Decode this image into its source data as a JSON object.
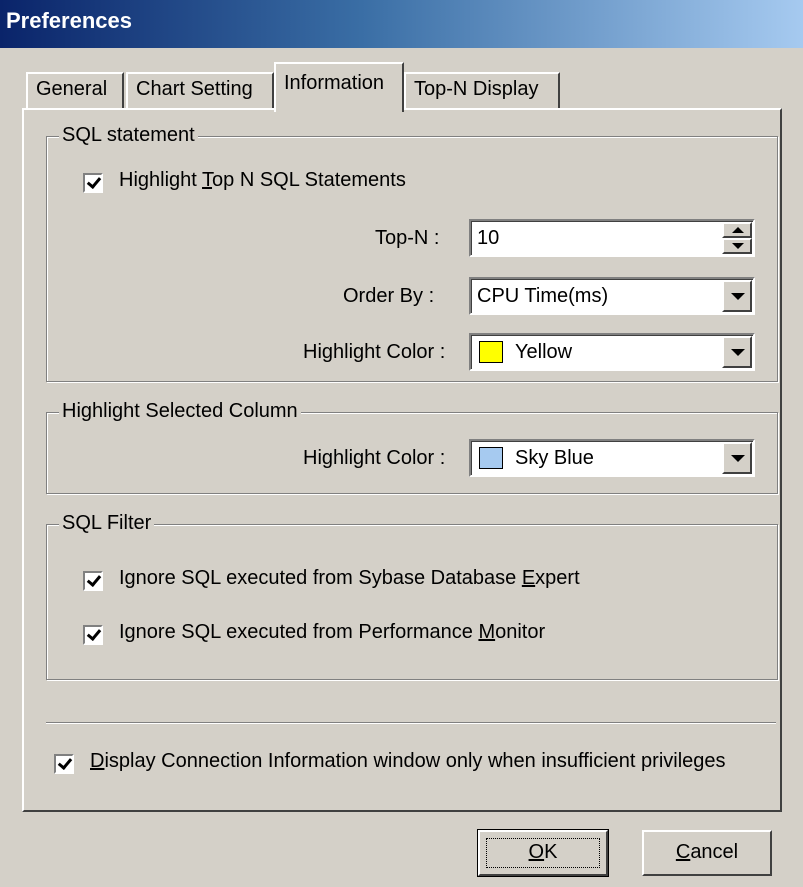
{
  "window": {
    "title": "Preferences"
  },
  "tabs": [
    {
      "label": "General",
      "active": false
    },
    {
      "label": "Chart Setting",
      "active": false
    },
    {
      "label": "Information",
      "active": true
    },
    {
      "label": "Top-N Display",
      "active": false
    }
  ],
  "sql_statement": {
    "legend": "SQL statement",
    "highlight_top_n": {
      "pre": "Highlight ",
      "key": "T",
      "post": "op N SQL Statements",
      "checked": true
    },
    "top_n": {
      "label": "Top-N :",
      "value": "10"
    },
    "order_by": {
      "label": "Order By :",
      "value": "CPU Time(ms)"
    },
    "highlight_color": {
      "label": "Highlight Color :",
      "value": "Yellow",
      "swatch": "#ffff00"
    }
  },
  "selected_column": {
    "legend": "Highlight Selected Column",
    "highlight_color": {
      "label": "Highlight Color :",
      "value": "Sky Blue",
      "swatch": "#a6caf0"
    }
  },
  "sql_filter": {
    "legend": "SQL Filter",
    "ignore_expert": {
      "pre": "Ignore SQL executed from Sybase Database ",
      "key": "E",
      "post": "xpert",
      "checked": true
    },
    "ignore_monitor": {
      "pre": "Ignore SQL executed from Performance ",
      "key": "M",
      "post": "onitor",
      "checked": true
    }
  },
  "display_connection": {
    "pre": "",
    "key": "D",
    "post": "isplay Connection Information window only when insufficient privileges",
    "checked": true
  },
  "buttons": {
    "ok": {
      "key": "O",
      "post": "K"
    },
    "cancel": {
      "key": "C",
      "post": "ancel"
    }
  },
  "colors": {
    "titlebar_start": "#0a246a",
    "face": "#d4d0c8",
    "yellow": "#ffff00",
    "sky_blue": "#a6caf0"
  },
  "icons": [
    "checkbox-checked-icon",
    "spin-up-icon",
    "spin-down-icon",
    "dropdown-arrow-icon"
  ]
}
